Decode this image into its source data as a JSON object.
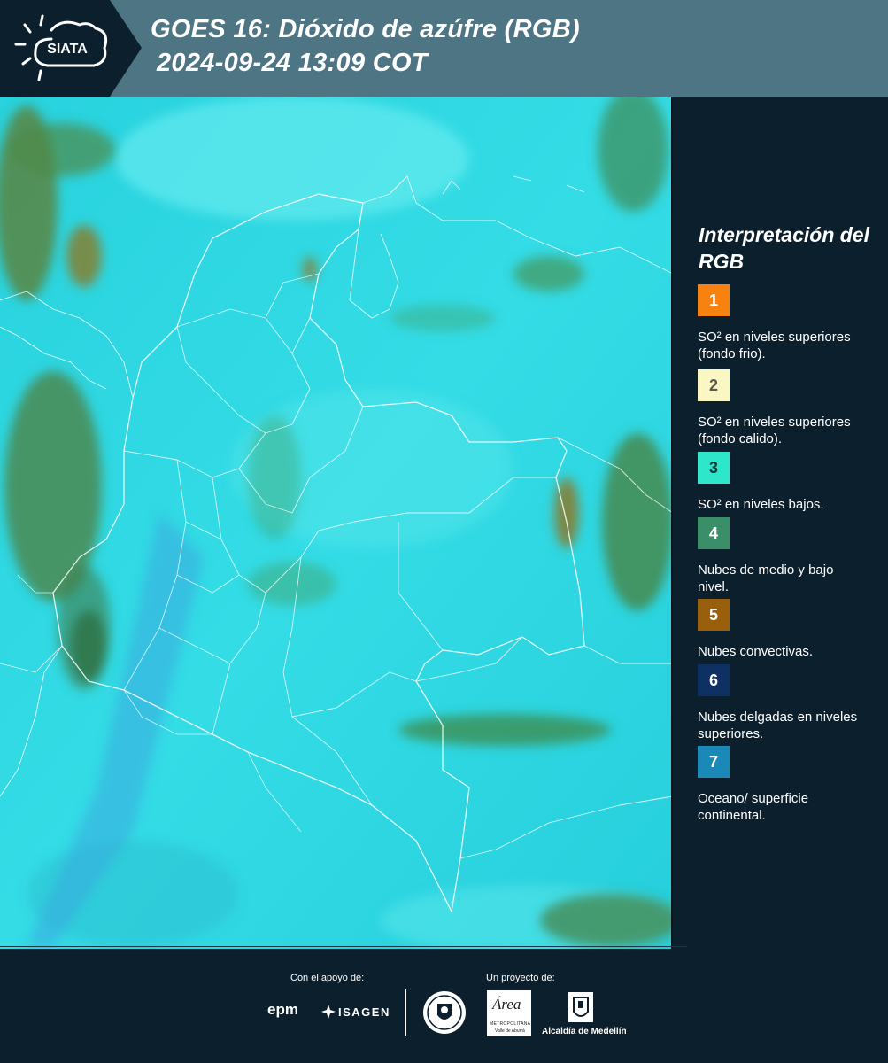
{
  "header": {
    "logo_text": "SIATA",
    "title_line1": "GOES 16: Dióxido de azúfre (RGB)",
    "title_line2": "2024-09-24 13:09 COT"
  },
  "map": {
    "product": "SO2 RGB composite",
    "base_color": "#2fd6e0",
    "region": "Colombia"
  },
  "legend": {
    "title": "Interpretación del RGB",
    "items": [
      {
        "num": "1",
        "color": "#f7820f",
        "num_color": "#ffffff",
        "text": "SO² en niveles superiores (fondo frio)."
      },
      {
        "num": "2",
        "color": "#fbf7c4",
        "num_color": "#5a5a4a",
        "text": "SO² en niveles superiores (fondo calido)."
      },
      {
        "num": "3",
        "color": "#2ee6c9",
        "num_color": "#0c3a3a",
        "text": "SO² en niveles bajos."
      },
      {
        "num": "4",
        "color": "#3b8f68",
        "num_color": "#ffffff",
        "text": "Nubes de medio y bajo nivel."
      },
      {
        "num": "5",
        "color": "#9a5f0d",
        "num_color": "#ffffff",
        "text": "Nubes convectivas."
      },
      {
        "num": "6",
        "color": "#0f3063",
        "num_color": "#ffffff",
        "text": "Nubes delgadas en niveles superiores."
      },
      {
        "num": "7",
        "color": "#1a89b8",
        "num_color": "#ffffff",
        "text": "Oceano/ superficie continental."
      }
    ]
  },
  "footer": {
    "support_label": "Con el apoyo de:",
    "project_label": "Un proyecto de:",
    "epm": "epm",
    "isagen": "ISAGEN",
    "area_word": "Área",
    "area_sub1": "METROPOLITANA",
    "area_sub2": "Valle de Aburrá",
    "alcaldia": "Alcaldía de Medellín"
  }
}
